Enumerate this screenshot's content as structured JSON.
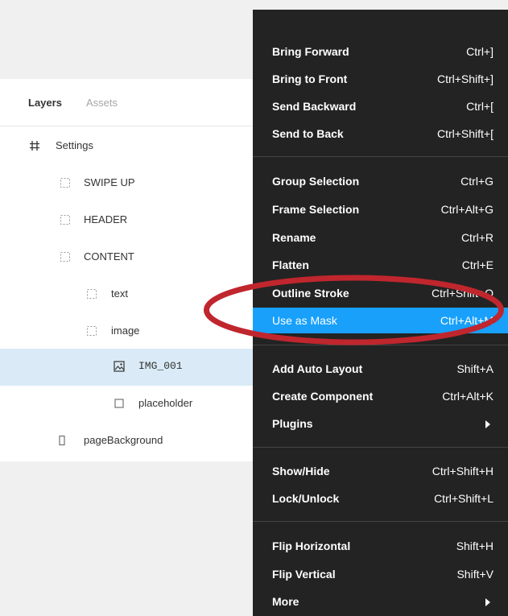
{
  "layers_panel": {
    "tabs": [
      {
        "label": "Layers",
        "active": true
      },
      {
        "label": "Assets",
        "active": false
      }
    ],
    "layers": [
      {
        "label": "Settings",
        "icon": "frame-hash-icon",
        "selected": false
      },
      {
        "label": "SWIPE UP",
        "icon": "group-dotted-icon",
        "selected": false
      },
      {
        "label": "HEADER",
        "icon": "group-dotted-icon",
        "selected": false
      },
      {
        "label": "CONTENT",
        "icon": "group-dotted-icon",
        "selected": false
      },
      {
        "label": "text",
        "icon": "group-dotted-icon",
        "selected": false
      },
      {
        "label": "image",
        "icon": "group-dotted-icon",
        "selected": false
      },
      {
        "label": "IMG_001",
        "icon": "image-icon",
        "selected": true
      },
      {
        "label": "placeholder",
        "icon": "rectangle-icon",
        "selected": false
      },
      {
        "label": "pageBackground",
        "icon": "rectangle-icon",
        "selected": false
      }
    ]
  },
  "context_menu": {
    "items": [
      {
        "label": "Bring Forward",
        "shortcut": "Ctrl+]"
      },
      {
        "label": "Bring to Front",
        "shortcut": "Ctrl+Shift+]"
      },
      {
        "label": "Send Backward",
        "shortcut": "Ctrl+["
      },
      {
        "label": "Send to Back",
        "shortcut": "Ctrl+Shift+["
      },
      {
        "label": "Group Selection",
        "shortcut": "Ctrl+G"
      },
      {
        "label": "Frame Selection",
        "shortcut": "Ctrl+Alt+G"
      },
      {
        "label": "Rename",
        "shortcut": "Ctrl+R"
      },
      {
        "label": "Flatten",
        "shortcut": "Ctrl+E"
      },
      {
        "label": "Outline Stroke",
        "shortcut": "Ctrl+Shift+O"
      },
      {
        "label": "Use as Mask",
        "shortcut": "Ctrl+Alt+M",
        "highlighted": true
      },
      {
        "label": "Add Auto Layout",
        "shortcut": "Shift+A"
      },
      {
        "label": "Create Component",
        "shortcut": "Ctrl+Alt+K"
      },
      {
        "label": "Plugins",
        "submenu": true
      },
      {
        "label": "Show/Hide",
        "shortcut": "Ctrl+Shift+H"
      },
      {
        "label": "Lock/Unlock",
        "shortcut": "Ctrl+Shift+L"
      },
      {
        "label": "Flip Horizontal",
        "shortcut": "Shift+H"
      },
      {
        "label": "Flip Vertical",
        "shortcut": "Shift+V"
      },
      {
        "label": "More",
        "submenu": true
      }
    ]
  },
  "colors": {
    "menu_background": "#232323",
    "menu_highlight": "#18a0fb",
    "selected_layer": "#daebf7",
    "annotation_ring": "#c0262d"
  }
}
